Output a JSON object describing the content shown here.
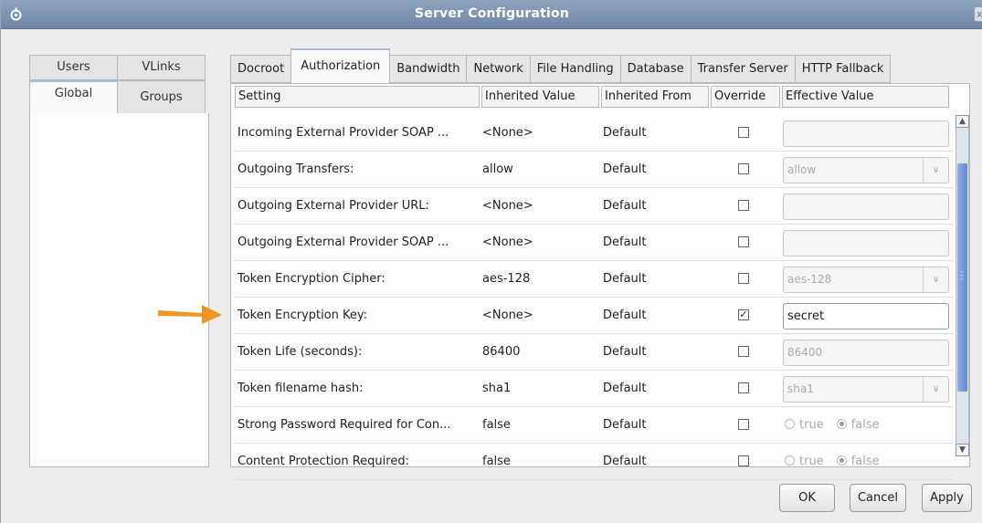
{
  "window": {
    "title": "Server Configuration",
    "close_glyph": "x"
  },
  "left_tabs": {
    "row1": [
      "Users",
      "VLinks"
    ],
    "row2": [
      "Global",
      "Groups"
    ],
    "selected": "Global"
  },
  "right_tabs": [
    "Docroot",
    "Authorization",
    "Bandwidth",
    "Network",
    "File Handling",
    "Database",
    "Transfer Server",
    "HTTP Fallback"
  ],
  "selected_right_tab": "Authorization",
  "columns": [
    "Setting",
    "Inherited Value",
    "Inherited From",
    "Override",
    "Effective Value"
  ],
  "rows": [
    {
      "setting": "Incoming External Provider SOAP ...",
      "inherited": "<None>",
      "from": "Default",
      "override": false,
      "effective_type": "text",
      "effective": ""
    },
    {
      "setting": "Outgoing Transfers:",
      "inherited": "allow",
      "from": "Default",
      "override": false,
      "effective_type": "combo",
      "effective": "allow"
    },
    {
      "setting": "Outgoing External Provider URL:",
      "inherited": "<None>",
      "from": "Default",
      "override": false,
      "effective_type": "text",
      "effective": ""
    },
    {
      "setting": "Outgoing External Provider SOAP ...",
      "inherited": "<None>",
      "from": "Default",
      "override": false,
      "effective_type": "text",
      "effective": ""
    },
    {
      "setting": "Token Encryption Cipher:",
      "inherited": "aes-128",
      "from": "Default",
      "override": false,
      "effective_type": "combo",
      "effective": "aes-128"
    },
    {
      "setting": "Token Encryption Key:",
      "inherited": "<None>",
      "from": "Default",
      "override": true,
      "effective_type": "text",
      "effective": "secret"
    },
    {
      "setting": "Token Life (seconds):",
      "inherited": "86400",
      "from": "Default",
      "override": false,
      "effective_type": "text",
      "effective": "86400"
    },
    {
      "setting": "Token filename hash:",
      "inherited": "sha1",
      "from": "Default",
      "override": false,
      "effective_type": "combo",
      "effective": "sha1"
    },
    {
      "setting": "Strong Password Required for Con...",
      "inherited": "false",
      "from": "Default",
      "override": false,
      "effective_type": "radio",
      "effective": "false",
      "options": [
        "true",
        "false"
      ]
    },
    {
      "setting": "Content Protection Required:",
      "inherited": "false",
      "from": "Default",
      "override": false,
      "effective_type": "radio",
      "effective": "false",
      "options": [
        "true",
        "false"
      ]
    }
  ],
  "buttons": {
    "ok": "OK",
    "cancel": "Cancel",
    "apply": "Apply"
  },
  "colors": {
    "titlebar": "#7a90ae",
    "annotation_arrow": "#f0961e",
    "scroll_thumb": "#6f96d8"
  }
}
